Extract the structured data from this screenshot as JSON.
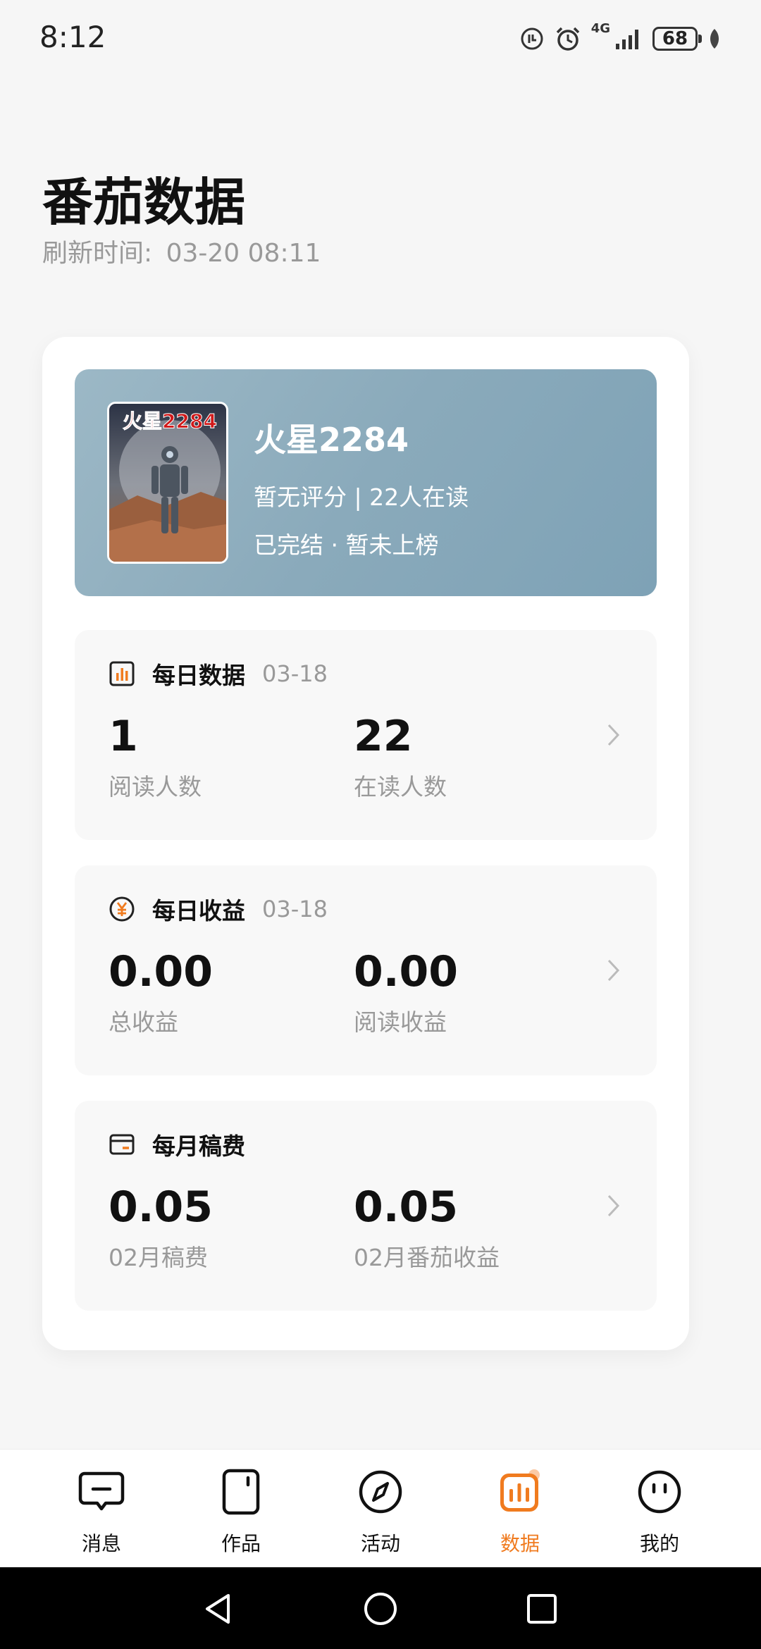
{
  "status_bar": {
    "time": "8:12",
    "network": "4G",
    "battery": "68"
  },
  "page": {
    "title": "番茄数据",
    "refresh_label": "刷新时间:",
    "refresh_time": "03-20 08:11"
  },
  "book": {
    "title": "火星2284",
    "stats": "暂无评分 | 22人在读",
    "status": "已完结 · 暂未上榜",
    "cover_text": "火星2284"
  },
  "daily_data": {
    "title": "每日数据",
    "date": "03-18",
    "metrics": [
      {
        "value": "1",
        "label": "阅读人数"
      },
      {
        "value": "22",
        "label": "在读人数"
      }
    ]
  },
  "daily_income": {
    "title": "每日收益",
    "date": "03-18",
    "metrics": [
      {
        "value": "0.00",
        "label": "总收益"
      },
      {
        "value": "0.00",
        "label": "阅读收益"
      }
    ]
  },
  "monthly_fee": {
    "title": "每月稿费",
    "metrics": [
      {
        "value": "0.05",
        "label": "02月稿费"
      },
      {
        "value": "0.05",
        "label": "02月番茄收益"
      }
    ]
  },
  "bottom_nav": {
    "items": [
      {
        "label": "消息",
        "icon": "message-icon"
      },
      {
        "label": "作品",
        "icon": "works-icon"
      },
      {
        "label": "活动",
        "icon": "compass-icon"
      },
      {
        "label": "数据",
        "icon": "data-chart-icon",
        "active": true
      },
      {
        "label": "我的",
        "icon": "profile-icon"
      }
    ]
  },
  "colors": {
    "accent": "#f07b1f",
    "book_card": "#8aaabb",
    "muted_text": "#999999"
  }
}
